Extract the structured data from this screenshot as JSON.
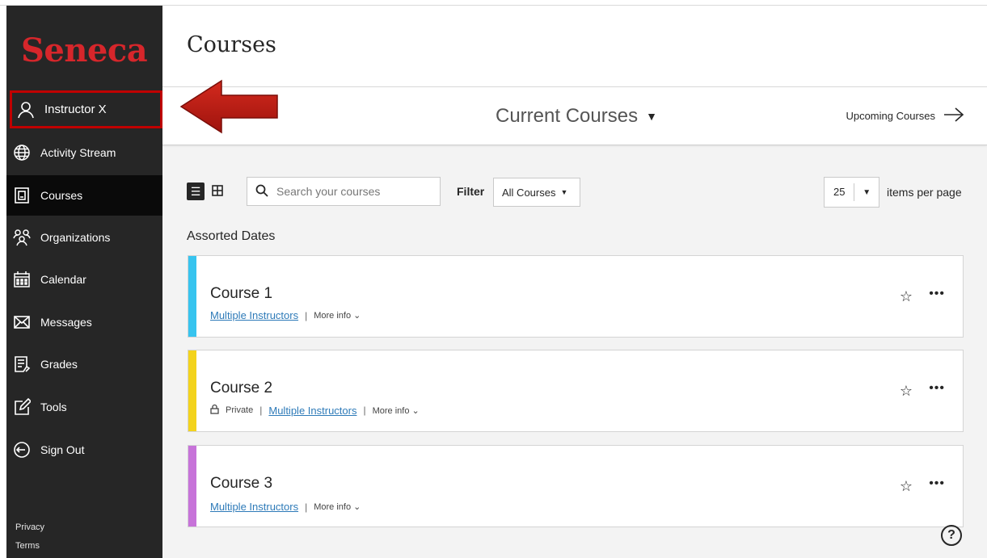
{
  "sidebar": {
    "logo": "Seneca",
    "items": [
      {
        "label": "Instructor X",
        "icon": "user-icon"
      },
      {
        "label": "Activity Stream",
        "icon": "globe-icon"
      },
      {
        "label": "Courses",
        "icon": "courses-icon"
      },
      {
        "label": "Organizations",
        "icon": "organizations-icon"
      },
      {
        "label": "Calendar",
        "icon": "calendar-icon"
      },
      {
        "label": "Messages",
        "icon": "envelope-icon"
      },
      {
        "label": "Grades",
        "icon": "grades-icon"
      },
      {
        "label": "Tools",
        "icon": "tools-icon"
      },
      {
        "label": "Sign Out",
        "icon": "sign-out-icon"
      }
    ],
    "footer": {
      "privacy": "Privacy",
      "terms": "Terms"
    }
  },
  "header": {
    "title": "Courses"
  },
  "tabs": {
    "current": "Current Courses",
    "upcoming": "Upcoming Courses"
  },
  "toolbar": {
    "search_placeholder": "Search your courses",
    "filter_label": "Filter",
    "filter_value": "All Courses",
    "per_page_value": "25",
    "per_page_label": "items per page"
  },
  "group_label": "Assorted Dates",
  "courses": [
    {
      "title": "Course 1",
      "private": "",
      "instructors": "Multiple Instructors",
      "more_info": "More info",
      "color": "#37c4ef"
    },
    {
      "title": "Course 2",
      "private": "Private",
      "instructors": "Multiple Instructors",
      "more_info": "More info",
      "color": "#f3d31c"
    },
    {
      "title": "Course 3",
      "private": "",
      "instructors": "Multiple Instructors",
      "more_info": "More info",
      "color": "#c773d9"
    }
  ],
  "colors": {
    "brand": "#d6262b",
    "sidebar": "#262626",
    "annotation": "#c00000"
  }
}
